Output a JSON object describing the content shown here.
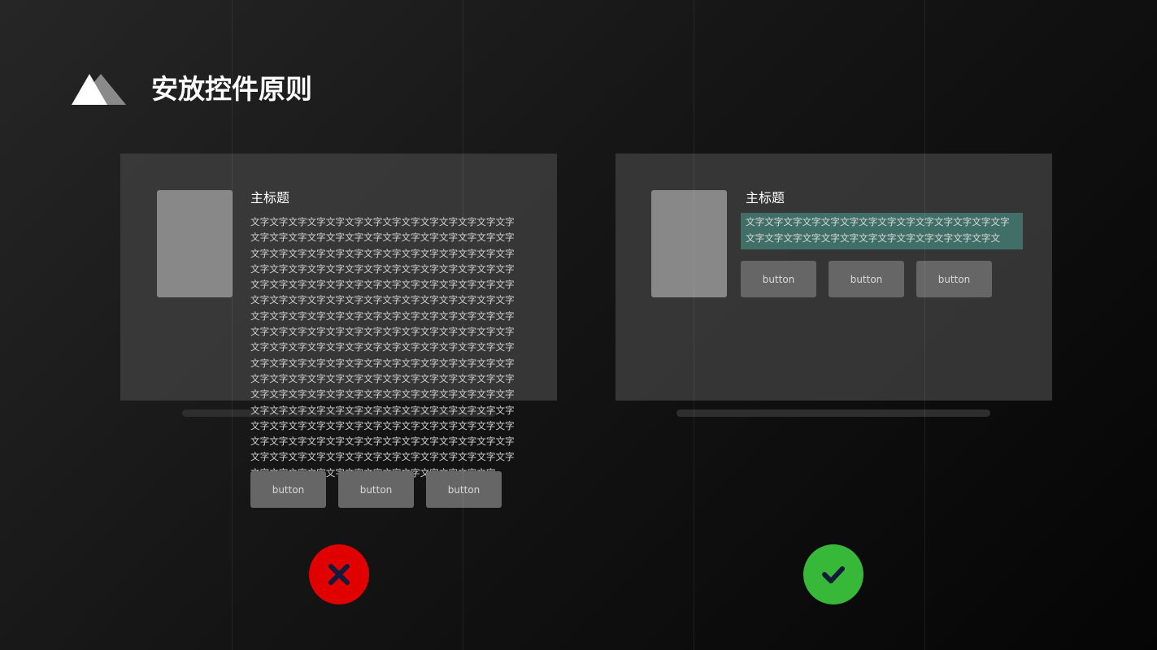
{
  "page": {
    "title": "安放控件原则",
    "logo_icon": "mountain-logo-icon"
  },
  "bad_example": {
    "heading": "主标题",
    "body_text": "文字文字文字文字文字文字文字文字文字文字文字文字文字文字文字文字文字文字文字文字文字文字文字文字文字文字文字文字文字文字文字文字文字文字文字文字文字文字文字文字文字文字文字文字文字文字文字文字文字文字文字文字文字文字文字文字文字文字文字文字文字文字文字文字文字文字文字文字文字文字文字文字文字文字文字文字文字文字文字文字文字文字文字文字文字文字文字文字文字文字文字文字文字文字文字文字文字文字文字文字文字文字文字文字文字文字文字文字文字文字文字文字文字文字文字文字文字文字文字文字文字文字文字文字文字文字文字文字文字文字文字文字文字文字文字文字文字文字文字文字文字文字文字文字文字文字文字文字文字文字文字文字文字文字文字文字文字文字文字文字文字文字文字文字文字文字文字文字文字文字文字文字文字文字文字文字文字文字文字文字文字文字文字文字文字文字文字文字文字文字文字文字文字文字文字文字文字文字文字文字文字文字文字文字文字文字文字文字文字文字文字文字文字文字文字文字文字文字文字文字文字文字文字文字文字文字文字文字文字文字文字文字文字文字文字文字文字",
    "buttons": [
      "button",
      "button",
      "button"
    ],
    "verdict_icon": "cross-icon",
    "verdict_color": "#e00000"
  },
  "good_example": {
    "heading": "主标题",
    "body_text": "文字文字文字文字文字文字文字文字文字文字文字文字文字文字文字文字文字文字文字文字文字文字文字文字文字文字文字文",
    "highlight_color": "#3f6f66",
    "buttons": [
      "button",
      "button",
      "button"
    ],
    "verdict_icon": "check-icon",
    "verdict_color": "#38b838"
  }
}
